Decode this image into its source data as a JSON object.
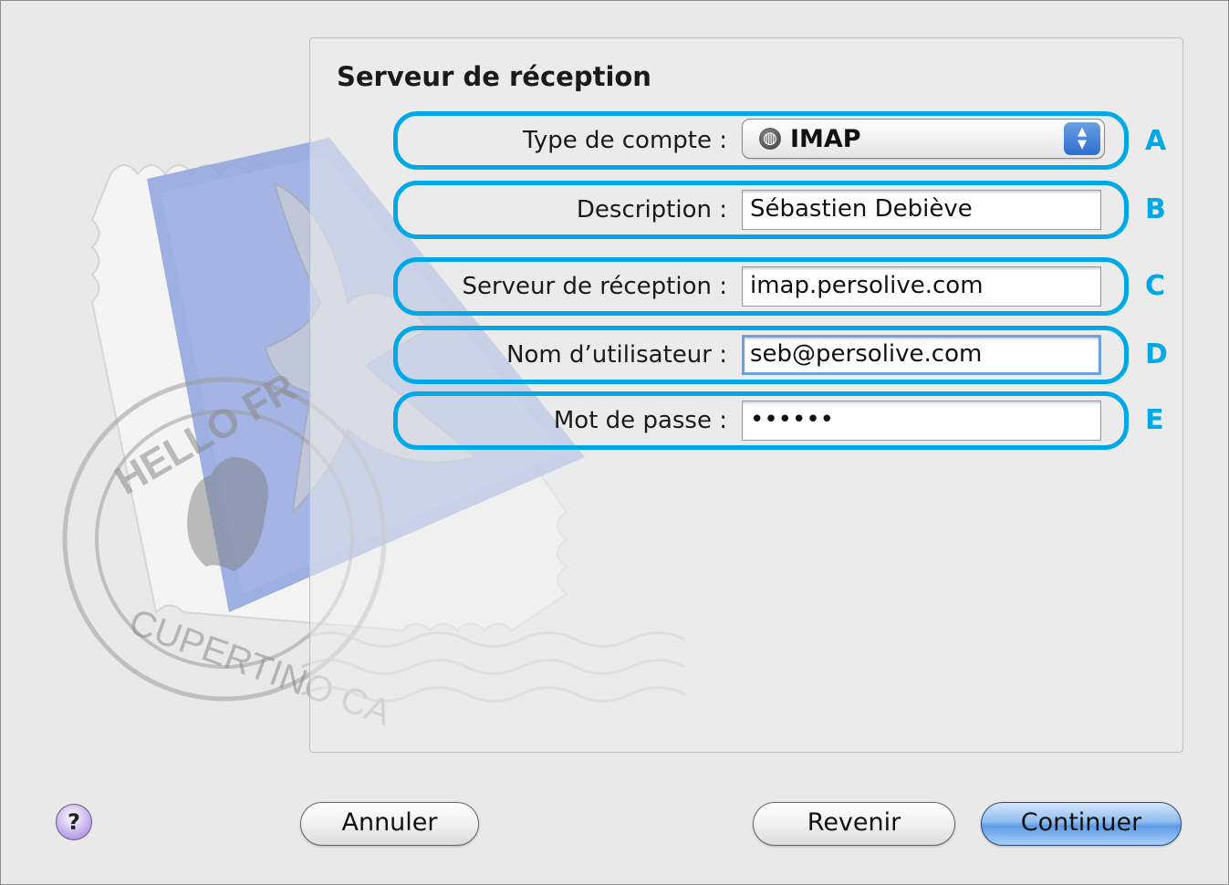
{
  "panel": {
    "title": "Serveur de réception"
  },
  "stamp": {
    "text_top": "HELLO FR",
    "text_bottom": "CUPERTINO CA"
  },
  "fields": [
    {
      "letter": "A",
      "label": "Type de compte :",
      "type": "popup",
      "value": "IMAP",
      "icon": "globe-icon"
    },
    {
      "letter": "B",
      "label": "Description :",
      "type": "text",
      "value": "Sébastien Debiève"
    },
    {
      "letter": "C",
      "label": "Serveur de réception :",
      "type": "text",
      "value": "imap.persolive.com"
    },
    {
      "letter": "D",
      "label": "Nom d’utilisateur :",
      "type": "text",
      "value": "seb@persolive.com",
      "focused": true
    },
    {
      "letter": "E",
      "label": "Mot de passe :",
      "type": "password",
      "value": "••••••"
    }
  ],
  "buttons": {
    "help": "?",
    "cancel": "Annuler",
    "back": "Revenir",
    "continue": "Continuer"
  },
  "colors": {
    "annotation": "#00a9e6",
    "focus_ring": "#6fa1d9"
  }
}
